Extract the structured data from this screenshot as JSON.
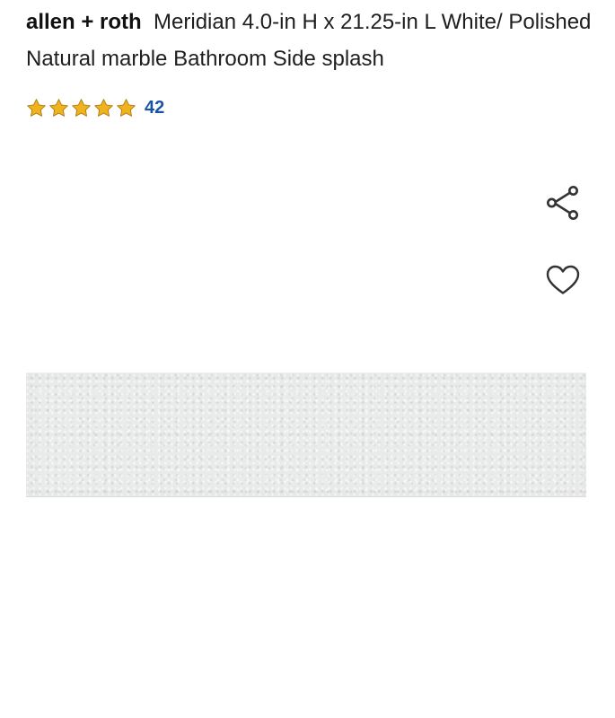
{
  "product": {
    "brand": "allen + roth",
    "name": "Meridian 4.0-in H x 21.25-in L White/ Polished Natural marble Bathroom Side splash"
  },
  "rating": {
    "stars": 5,
    "max_stars": 5,
    "review_count": "42",
    "star_color": "#f0b31e",
    "star_outline_color": "#b07d10",
    "count_color": "#1a53a6"
  },
  "actions": {
    "share_icon": "share-icon",
    "favorite_icon": "heart-icon"
  },
  "image": {
    "color": "#e9eaea"
  }
}
